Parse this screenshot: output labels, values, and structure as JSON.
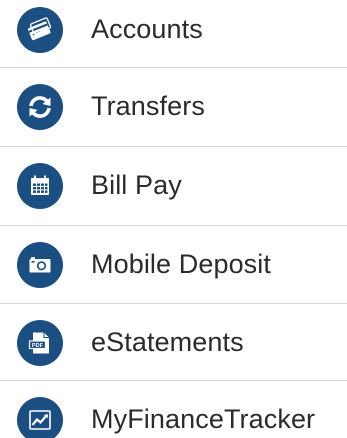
{
  "menu": {
    "items": [
      {
        "label": "Accounts",
        "icon": "credit-card-icon"
      },
      {
        "label": "Transfers",
        "icon": "refresh-arrows-icon"
      },
      {
        "label": "Bill Pay",
        "icon": "calendar-icon"
      },
      {
        "label": "Mobile Deposit",
        "icon": "camera-icon"
      },
      {
        "label": "eStatements",
        "icon": "pdf-document-icon"
      },
      {
        "label": "MyFinanceTracker",
        "icon": "trend-chart-icon"
      }
    ]
  },
  "colors": {
    "icon_background": "#1b4f82",
    "icon_foreground": "#ffffff",
    "text": "#2b2b2b",
    "divider": "#d7d7d7",
    "background": "#ffffff"
  },
  "icons": {
    "pdf_text": "PDF"
  }
}
